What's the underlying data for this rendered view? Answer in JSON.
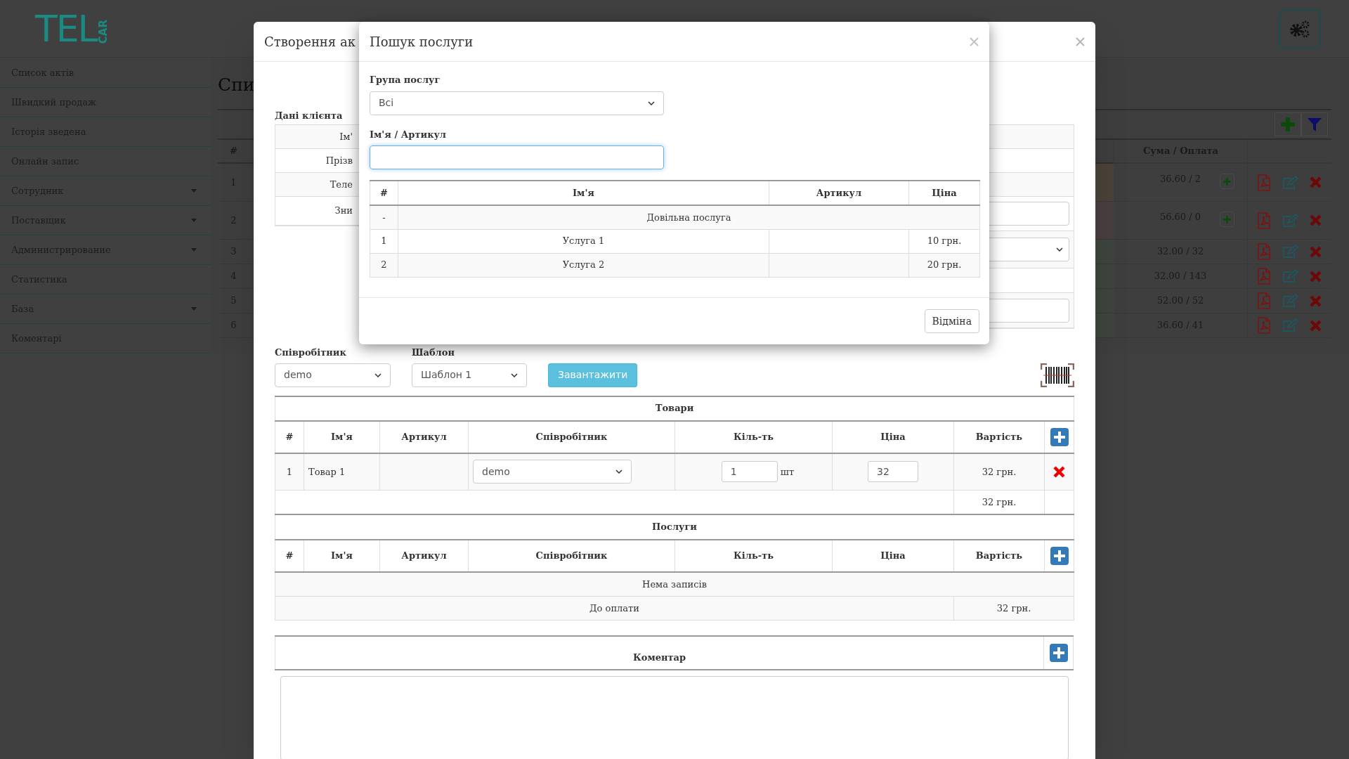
{
  "logo": {
    "text": "TEL",
    "sub": "CAR"
  },
  "sidebar": [
    {
      "label": "Список актів",
      "has_submenu": false
    },
    {
      "label": "Швидкий продаж",
      "has_submenu": false
    },
    {
      "label": "Історія зведена",
      "has_submenu": false
    },
    {
      "label": "Онлайн запис",
      "has_submenu": false
    },
    {
      "label": "Сотрудник",
      "has_submenu": true
    },
    {
      "label": "Поставщик",
      "has_submenu": true
    },
    {
      "label": "Администрирование",
      "has_submenu": true
    },
    {
      "label": "Статистика",
      "has_submenu": false
    },
    {
      "label": "База",
      "has_submenu": true
    },
    {
      "label": "Коментарі",
      "has_submenu": false
    }
  ],
  "page": {
    "title": "Спи",
    "columns": [
      "#",
      "Сума / Оплата"
    ],
    "rows": [
      {
        "number": "1",
        "amount": "36.60 / 2",
        "color": "#4b4339",
        "add_payment": true
      },
      {
        "number": "2",
        "amount": "56.60 / 0",
        "color": "#4a3f40",
        "add_payment": true
      },
      {
        "number": "3",
        "amount": "32.00 / 32",
        "color": "#3e453e",
        "add_payment": false
      },
      {
        "number": "4",
        "amount": "32.00 / 143",
        "color": "#3e453e",
        "add_payment": false
      },
      {
        "number": "5",
        "amount": "52.00 / 52",
        "color": "#3e453e",
        "add_payment": false
      },
      {
        "number": "6",
        "amount": "36.60 / 41",
        "color": "#3e453e",
        "add_payment": false
      }
    ]
  },
  "act_modal": {
    "title": "Створення ак",
    "client_section": "Дані клієнта",
    "client_labels": [
      "Ім'",
      "Прізв",
      "Теле",
      "Зни"
    ],
    "client_fields": [
      {
        "kind": "empty"
      },
      {
        "kind": "empty"
      },
      {
        "kind": "empty"
      },
      {
        "kind": "input"
      },
      {
        "kind": "select"
      },
      {
        "kind": "empty"
      },
      {
        "kind": "input"
      }
    ],
    "employee_label": "Співробітник",
    "employee_value": "demo",
    "template_label": "Шаблон",
    "template_value": "Шаблон 1",
    "load_button": "Завантажити",
    "goods": {
      "title": "Товари",
      "columns": [
        "#",
        "Ім'я",
        "Артикул",
        "Співробітник",
        "Кіль-ть",
        "Ціна",
        "Вартість"
      ],
      "rows": [
        {
          "number": "1",
          "name": "Товар 1",
          "employee": "demo",
          "quantity": "1",
          "unit": "шт",
          "price": "32",
          "cost": "32 грн."
        }
      ],
      "total": "32 грн."
    },
    "services": {
      "title": "Послуги",
      "columns": [
        "#",
        "Ім'я",
        "Артикул",
        "Співробітник",
        "Кіль-ть",
        "Ціна",
        "Вартість"
      ],
      "empty_text": "Нема записів",
      "due_label": "До оплати",
      "due": "32 грн."
    },
    "comment": {
      "title": "Коментар"
    }
  },
  "search_modal": {
    "title": "Пошук послуги",
    "group_label": "Група послуг",
    "group_value": "Всі",
    "query_label": "Ім'я / Артикул",
    "query_focused": true,
    "columns": [
      "#",
      "Ім'я",
      "Артикул",
      "Ціна"
    ],
    "rows": [
      {
        "kind": "custom",
        "number": "-",
        "name": "Довільна послуга"
      },
      {
        "kind": "item",
        "number": "1",
        "name": "Услуга 1",
        "price": "10 грн."
      },
      {
        "kind": "item",
        "number": "2",
        "name": "Услуга 2",
        "price": "20 грн."
      }
    ],
    "cancel_button": "Відміна"
  }
}
